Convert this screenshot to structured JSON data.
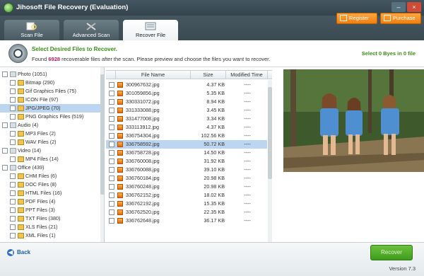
{
  "window": {
    "title": "Jihosoft File Recovery (Evaluation)",
    "minimize": "–",
    "close": "×"
  },
  "header_buttons": {
    "register": "Register",
    "purchase": "Purchase"
  },
  "tabs": [
    {
      "label": "Scan File"
    },
    {
      "label": "Advanced Scan"
    },
    {
      "label": "Recover File"
    }
  ],
  "info": {
    "title": "Select Desired Files to Recover.",
    "desc_prefix": "Found ",
    "found_count": "6928",
    "desc_suffix": " recoverable files after the scan. Please preview and choose the files you want to recover.",
    "selected": "Select 0 Byes in 0 file"
  },
  "tree": [
    {
      "label": "Photo (1051)",
      "level": 0
    },
    {
      "label": "Bitmap (290)",
      "level": 1
    },
    {
      "label": "Gif Graphics Files (75)",
      "level": 1
    },
    {
      "label": "ICON File (97)",
      "level": 1
    },
    {
      "label": "JPG/JPEG (70)",
      "level": 1,
      "selected": true
    },
    {
      "label": "PNG Graphics Files (519)",
      "level": 1
    },
    {
      "label": "Audio (4)",
      "level": 0
    },
    {
      "label": "MP3 Files (2)",
      "level": 1
    },
    {
      "label": "WAV Files (2)",
      "level": 1
    },
    {
      "label": "Video (14)",
      "level": 0
    },
    {
      "label": "MP4 Files (14)",
      "level": 1
    },
    {
      "label": "Office (439)",
      "level": 0
    },
    {
      "label": "CHM Files (6)",
      "level": 1
    },
    {
      "label": "DOC Files (8)",
      "level": 1
    },
    {
      "label": "HTML Files (16)",
      "level": 1
    },
    {
      "label": "PDF Files (4)",
      "level": 1
    },
    {
      "label": "PPT Files (3)",
      "level": 1
    },
    {
      "label": "TXT Files (380)",
      "level": 1
    },
    {
      "label": "XLS Files (21)",
      "level": 1
    },
    {
      "label": "XML Files (1)",
      "level": 1
    }
  ],
  "filelist": {
    "columns": [
      "File Name",
      "Size",
      "Modified Time"
    ],
    "rows": [
      {
        "name": "300967632.jpg",
        "size": "4.37 KB",
        "time": "----"
      },
      {
        "name": "301059856.jpg",
        "size": "5.35 KB",
        "time": "----"
      },
      {
        "name": "330331072.jpg",
        "size": "8.94 KB",
        "time": "----"
      },
      {
        "name": "331333088.jpg",
        "size": "3.45 KB",
        "time": "----"
      },
      {
        "name": "331477008.jpg",
        "size": "3.34 KB",
        "time": "----"
      },
      {
        "name": "333113912.jpg",
        "size": "4.37 KB",
        "time": "----"
      },
      {
        "name": "336754304.jpg",
        "size": "102.56 KB",
        "time": "----"
      },
      {
        "name": "336758592.jpg",
        "size": "50.72 KB",
        "time": "----",
        "selected": true
      },
      {
        "name": "336758728.jpg",
        "size": "14.50 KB",
        "time": "----"
      },
      {
        "name": "336760008.jpg",
        "size": "31.92 KB",
        "time": "----"
      },
      {
        "name": "336760088.jpg",
        "size": "39.10 KB",
        "time": "----"
      },
      {
        "name": "336760184.jpg",
        "size": "20.98 KB",
        "time": "----"
      },
      {
        "name": "336760248.jpg",
        "size": "20.98 KB",
        "time": "----"
      },
      {
        "name": "336762152.jpg",
        "size": "18.02 KB",
        "time": "----"
      },
      {
        "name": "336762192.jpg",
        "size": "15.35 KB",
        "time": "----"
      },
      {
        "name": "336762520.jpg",
        "size": "22.35 KB",
        "time": "----"
      },
      {
        "name": "336762648.jpg",
        "size": "36.17 KB",
        "time": "----"
      }
    ]
  },
  "bottom": {
    "back": "Back",
    "recover": "Recover",
    "version": "Version 7.3"
  },
  "colors": {
    "accent_green": "#3c8d1a",
    "selection": "#bcd6f1",
    "orange": "#f07f10"
  },
  "icons": [
    "app-logo-icon",
    "register-icon",
    "purchase-icon",
    "scan-file-icon",
    "advanced-scan-icon",
    "recover-file-icon",
    "info-magnifier-icon",
    "back-arrow-icon",
    "folder-icon",
    "jpg-file-icon"
  ]
}
